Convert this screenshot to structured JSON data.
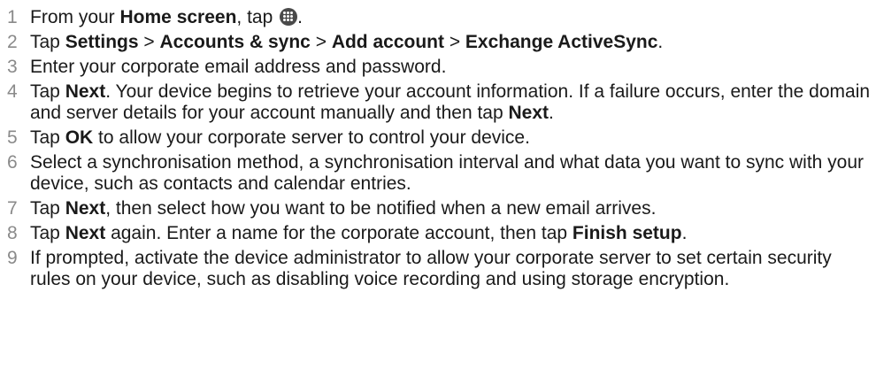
{
  "steps": [
    {
      "n": "1",
      "parts": [
        {
          "t": "From your ",
          "b": false
        },
        {
          "t": "Home screen",
          "b": true
        },
        {
          "t": ", tap ",
          "b": false
        },
        {
          "icon": "apps-icon"
        },
        {
          "t": ".",
          "b": false
        }
      ]
    },
    {
      "n": "2",
      "parts": [
        {
          "t": "Tap ",
          "b": false
        },
        {
          "t": "Settings",
          "b": true
        },
        {
          "t": " > ",
          "b": false
        },
        {
          "t": "Accounts & sync",
          "b": true
        },
        {
          "t": " > ",
          "b": false
        },
        {
          "t": "Add account",
          "b": true
        },
        {
          "t": " > ",
          "b": false
        },
        {
          "t": "Exchange ActiveSync",
          "b": true
        },
        {
          "t": ".",
          "b": false
        }
      ]
    },
    {
      "n": "3",
      "parts": [
        {
          "t": "Enter your corporate email address and password.",
          "b": false
        }
      ]
    },
    {
      "n": "4",
      "parts": [
        {
          "t": "Tap ",
          "b": false
        },
        {
          "t": "Next",
          "b": true
        },
        {
          "t": ". Your device begins to retrieve your account information. If a failure occurs, enter the domain and server details for your account manually and then tap ",
          "b": false
        },
        {
          "t": "Next",
          "b": true
        },
        {
          "t": ".",
          "b": false
        }
      ]
    },
    {
      "n": "5",
      "parts": [
        {
          "t": "Tap ",
          "b": false
        },
        {
          "t": "OK",
          "b": true
        },
        {
          "t": " to allow your corporate server to control your device.",
          "b": false
        }
      ]
    },
    {
      "n": "6",
      "parts": [
        {
          "t": "Select a synchronisation method, a synchronisation interval and what data you want to sync with your device, such as contacts and calendar entries.",
          "b": false
        }
      ]
    },
    {
      "n": "7",
      "parts": [
        {
          "t": "Tap ",
          "b": false
        },
        {
          "t": "Next",
          "b": true
        },
        {
          "t": ", then select how you want to be notified when a new email arrives.",
          "b": false
        }
      ]
    },
    {
      "n": "8",
      "parts": [
        {
          "t": "Tap ",
          "b": false
        },
        {
          "t": "Next",
          "b": true
        },
        {
          "t": " again. Enter a name for the corporate account, then tap ",
          "b": false
        },
        {
          "t": "Finish setup",
          "b": true
        },
        {
          "t": ".",
          "b": false
        }
      ]
    },
    {
      "n": "9",
      "parts": [
        {
          "t": "If prompted, activate the device administrator to allow your corporate server to set certain security rules on your device, such as disabling voice recording and using storage encryption.",
          "b": false
        }
      ]
    }
  ]
}
